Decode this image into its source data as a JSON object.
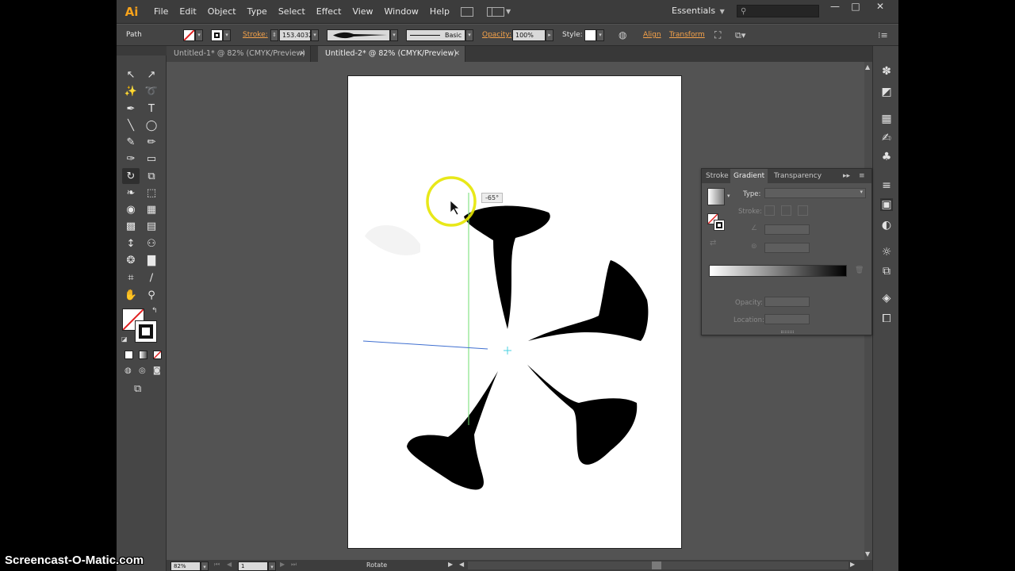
{
  "app": {
    "logo_text": "Ai",
    "menu": [
      "File",
      "Edit",
      "Object",
      "Type",
      "Select",
      "Effect",
      "View",
      "Window",
      "Help"
    ],
    "workspace": "Essentials",
    "window_controls": {
      "minimize": "—",
      "maximize": "□",
      "close": "✕"
    }
  },
  "control_bar": {
    "selection_type": "Path",
    "stroke_label": "Stroke:",
    "stroke_value": "153.4032",
    "profile_label": "Basic",
    "opacity_label": "Opacity:",
    "opacity_value": "100%",
    "style_label": "Style:",
    "align_label": "Align",
    "transform_label": "Transform"
  },
  "tabs": [
    {
      "label": "Untitled-1* @ 82% (CMYK/Preview)",
      "active": false
    },
    {
      "label": "Untitled-2* @ 82% (CMYK/Preview)",
      "active": true
    }
  ],
  "tools": [
    {
      "name": "selection-tool-icon",
      "glyph": "↖"
    },
    {
      "name": "direct-selection-tool-icon",
      "glyph": "↗"
    },
    {
      "name": "magic-wand-tool-icon",
      "glyph": "✨"
    },
    {
      "name": "lasso-tool-icon",
      "glyph": "➰"
    },
    {
      "name": "pen-tool-icon",
      "glyph": "✒"
    },
    {
      "name": "type-tool-icon",
      "glyph": "T"
    },
    {
      "name": "line-tool-icon",
      "glyph": "╲"
    },
    {
      "name": "ellipse-tool-icon",
      "glyph": "◯"
    },
    {
      "name": "paintbrush-tool-icon",
      "glyph": "✎"
    },
    {
      "name": "pencil-tool-icon",
      "glyph": "✏"
    },
    {
      "name": "blob-brush-tool-icon",
      "glyph": "✑"
    },
    {
      "name": "eraser-tool-icon",
      "glyph": "▭"
    },
    {
      "name": "rotate-tool-icon",
      "glyph": "↻"
    },
    {
      "name": "scale-tool-icon",
      "glyph": "⧉"
    },
    {
      "name": "warp-tool-icon",
      "glyph": "❧"
    },
    {
      "name": "free-transform-tool-icon",
      "glyph": "⬚"
    },
    {
      "name": "shape-builder-tool-icon",
      "glyph": "◉"
    },
    {
      "name": "perspective-grid-tool-icon",
      "glyph": "▦"
    },
    {
      "name": "mesh-tool-icon",
      "glyph": "▩"
    },
    {
      "name": "gradient-tool-icon",
      "glyph": "▤"
    },
    {
      "name": "eyedropper-tool-icon",
      "glyph": "↕"
    },
    {
      "name": "blend-tool-icon",
      "glyph": "⚇"
    },
    {
      "name": "symbol-sprayer-tool-icon",
      "glyph": "❂"
    },
    {
      "name": "column-graph-tool-icon",
      "glyph": "▇"
    },
    {
      "name": "artboard-tool-icon",
      "glyph": "⌗"
    },
    {
      "name": "slice-tool-icon",
      "glyph": "∕"
    },
    {
      "name": "hand-tool-icon",
      "glyph": "✋"
    },
    {
      "name": "zoom-tool-icon",
      "glyph": "⚲"
    }
  ],
  "canvas": {
    "rotate_readout": "-65°"
  },
  "status": {
    "zoom": "82%",
    "artboard_number": "1",
    "current_tool": "Rotate"
  },
  "gradient_panel": {
    "tabs": [
      "Stroke",
      "Gradient",
      "Transparency"
    ],
    "type_label": "Type:",
    "stroke_label": "Stroke:",
    "opacity_label": "Opacity:",
    "location_label": "Location:"
  },
  "watermark": "Screencast-O-Matic.com",
  "colors": {
    "accent_orange": "#f7a21b",
    "interface_bg": "#535353",
    "artboard": "#ffffff",
    "shape_fill": "#000000",
    "cursor_highlight": "#e6e600",
    "guide_green": "#6fdc6f",
    "guide_blue": "#3f6fd0"
  }
}
